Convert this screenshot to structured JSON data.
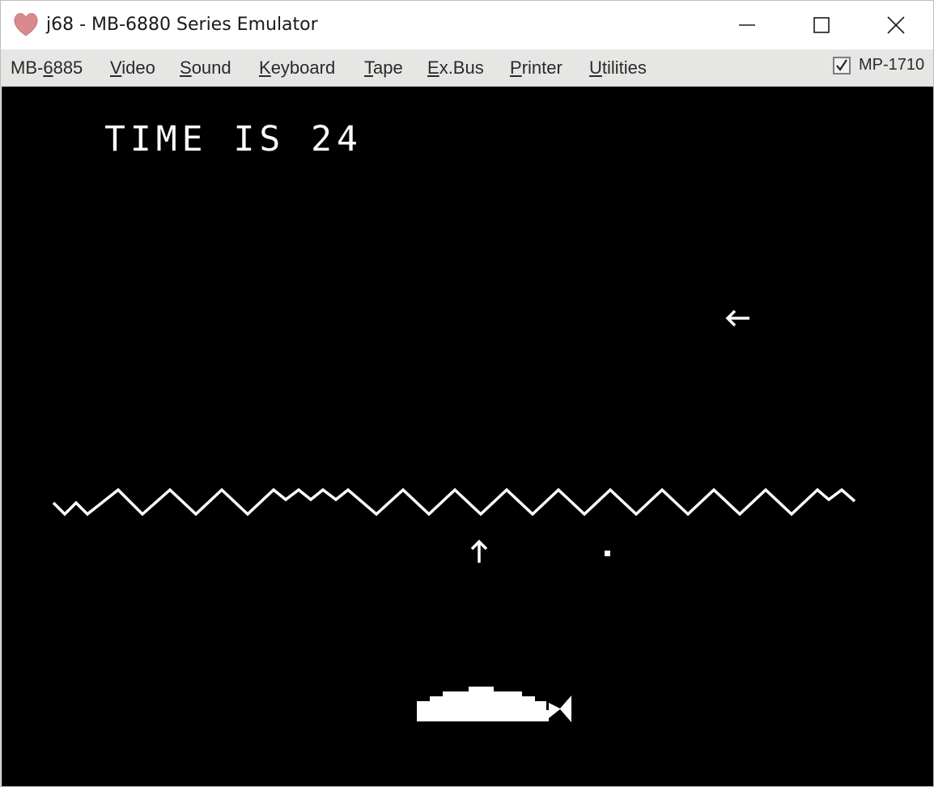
{
  "window": {
    "title": "j68 - MB-6880 Series Emulator"
  },
  "icons": {
    "app": "heart-icon",
    "minimize": "minimize-icon",
    "maximize": "maximize-icon",
    "close": "close-icon",
    "checkbox": "checkmark-icon"
  },
  "menu": {
    "items": [
      {
        "pre": "MB-",
        "acc": "6",
        "post": "885"
      },
      {
        "pre": "",
        "acc": "V",
        "post": "ideo"
      },
      {
        "pre": "",
        "acc": "S",
        "post": "ound"
      },
      {
        "pre": "",
        "acc": "K",
        "post": "eyboard"
      },
      {
        "pre": "",
        "acc": "T",
        "post": "ape"
      },
      {
        "pre": "",
        "acc": "E",
        "post": "x.Bus"
      },
      {
        "pre": "",
        "acc": "P",
        "post": "rinter"
      },
      {
        "pre": "",
        "acc": "U",
        "post": "tilities"
      }
    ],
    "toggle_label": "MP-1710",
    "toggle_checked": true
  },
  "screen": {
    "time_text": "TIME IS 24",
    "colors": {
      "background": "#000000",
      "foreground": "#ffffff"
    },
    "sprites": [
      "left-arrow",
      "up-arrow",
      "bullet",
      "submarine",
      "wave-line"
    ]
  },
  "colors": {
    "menubar": "#e6e6e4",
    "app_icon": "#d98a8f"
  }
}
